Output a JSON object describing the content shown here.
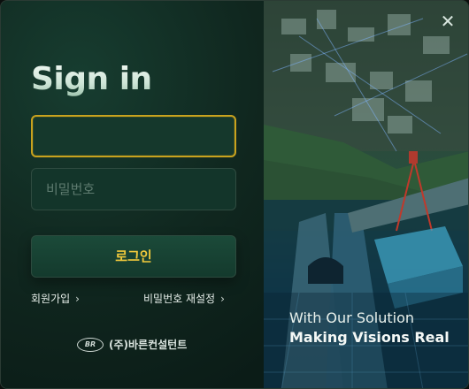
{
  "login": {
    "title": "Sign in",
    "id_field": {
      "value": "",
      "placeholder": ""
    },
    "password_field": {
      "value": "",
      "placeholder": "비밀번호"
    },
    "login_button": "로그인",
    "signup_link": "회원가입",
    "reset_password_link": "비밀번호 재설정",
    "chevron": "›"
  },
  "brand": {
    "logo_text": "BR",
    "company_name": "(주)바른컨설턴트"
  },
  "hero": {
    "tagline_line1": "With Our Solution",
    "tagline_line2": "Making Visions Real"
  },
  "window": {
    "close_glyph": "✕"
  },
  "colors": {
    "accent": "#f1c93c",
    "panel": "#10271f",
    "focus_border": "#c8a21e"
  },
  "icons": [
    "close-icon",
    "chevron-right-icon",
    "br-logo-icon"
  ]
}
